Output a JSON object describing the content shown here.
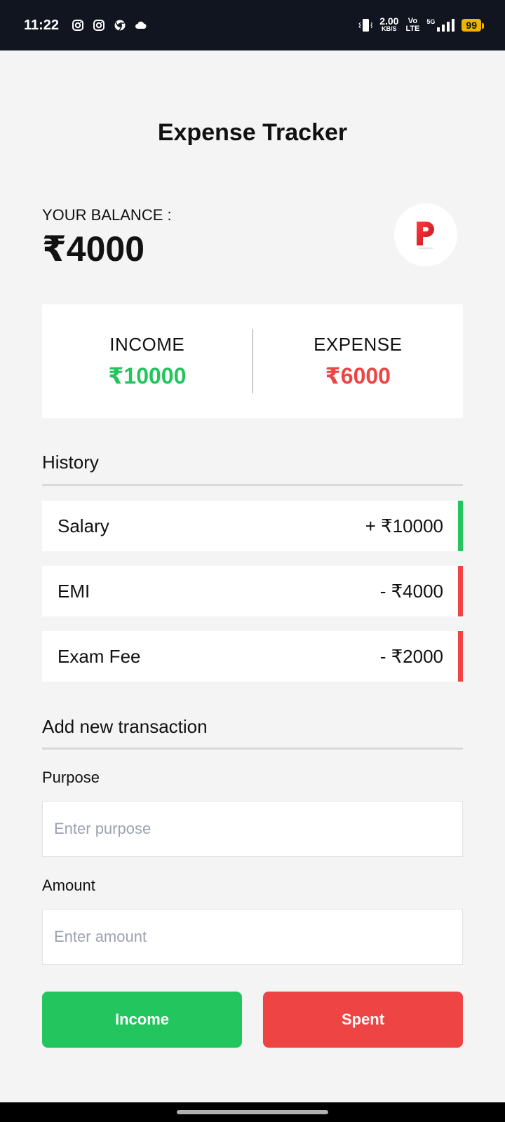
{
  "status_bar": {
    "time": "11:22",
    "net_speed": "2.00",
    "net_unit": "KB/S",
    "volte_top": "Vo",
    "volte_bottom": "LTE",
    "network": "5G",
    "battery": "99",
    "icons": [
      "instagram-icon",
      "instagram-icon",
      "chrome-icon",
      "cloud-icon",
      "vibrate-icon",
      "signal-icon",
      "battery-icon"
    ]
  },
  "app": {
    "title": "Expense Tracker",
    "balance_label": "YOUR BALANCE :",
    "balance_value": "₹4000",
    "avatar_letter": "P"
  },
  "summary": {
    "income_label": "INCOME",
    "income_value": "₹10000",
    "expense_label": "EXPENSE",
    "expense_value": "₹6000"
  },
  "history": {
    "title": "History",
    "items": [
      {
        "label": "Salary",
        "amount": "+ ₹10000",
        "type": "income"
      },
      {
        "label": "EMI",
        "amount": "- ₹4000",
        "type": "expense"
      },
      {
        "label": "Exam Fee",
        "amount": "- ₹2000",
        "type": "expense"
      }
    ]
  },
  "form": {
    "title": "Add new transaction",
    "purpose_label": "Purpose",
    "purpose_placeholder": "Enter purpose",
    "purpose_value": "",
    "amount_label": "Amount",
    "amount_placeholder": "Enter amount",
    "amount_value": "",
    "income_button": "Income",
    "spent_button": "Spent"
  },
  "colors": {
    "income": "#22c55e",
    "expense": "#ef4444",
    "background": "#f4f4f4",
    "status_bar": "#111520"
  }
}
